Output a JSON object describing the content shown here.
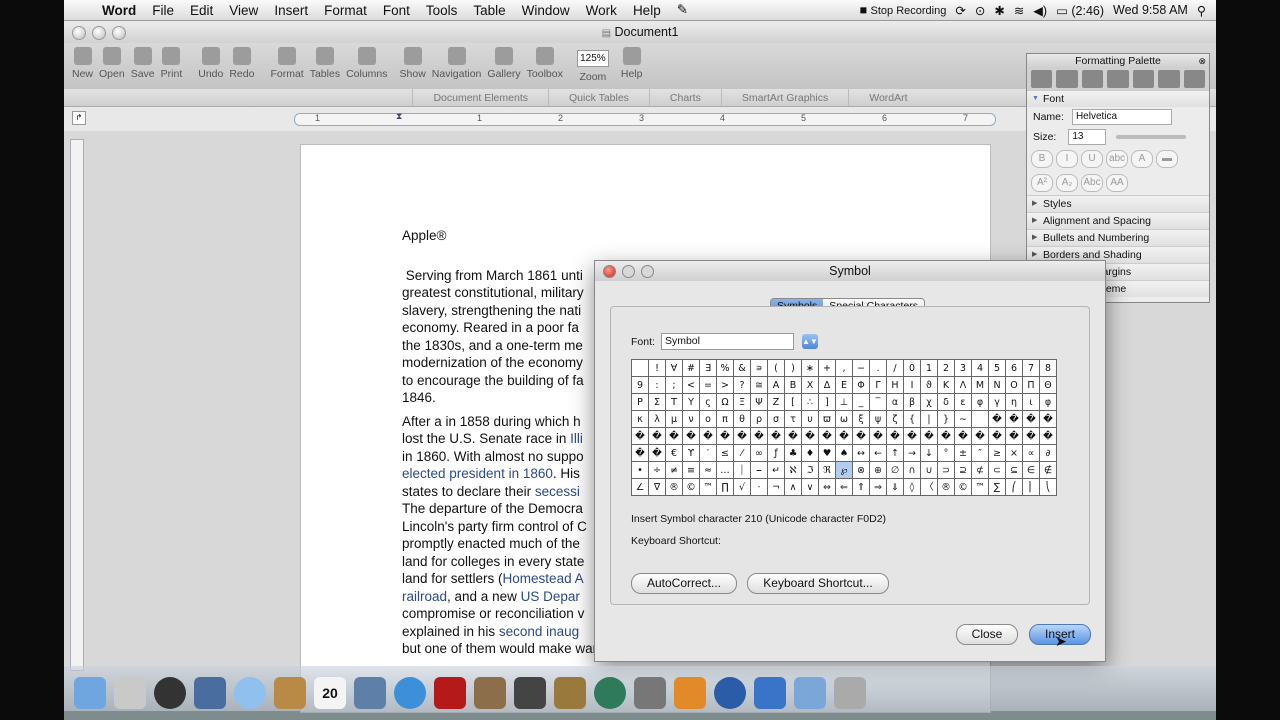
{
  "menubar": {
    "app_name": "Word",
    "items": [
      "File",
      "Edit",
      "View",
      "Insert",
      "Format",
      "Font",
      "Tools",
      "Table",
      "Window",
      "Work",
      "Help"
    ],
    "stop_recording": "Stop Recording",
    "battery": "(2:46)",
    "clock": "Wed 9:58 AM"
  },
  "window": {
    "title": "Document1"
  },
  "toolbar": {
    "items": [
      "New",
      "Open",
      "Save",
      "Print",
      "Undo",
      "Redo",
      "Format",
      "Tables",
      "Columns",
      "Show",
      "Navigation",
      "Gallery",
      "Toolbox",
      "Zoom",
      "Help"
    ],
    "zoom_value": "125%"
  },
  "ribbon": {
    "tabs": [
      "Document Elements",
      "Quick Tables",
      "Charts",
      "SmartArt Graphics",
      "WordArt"
    ]
  },
  "ruler": {
    "numbers": [
      "1",
      "1",
      "2",
      "3",
      "4",
      "5",
      "6",
      "7"
    ]
  },
  "document": {
    "heading": "Apple®",
    "p1": [
      " Serving from March 1861 unti",
      "greatest constitutional, military",
      "slavery, strengthening the nati",
      "economy. Reared in a poor fa",
      "the 1830s, and a one-term me",
      "modernization of the economy",
      "to encourage the building of fa",
      "1846."
    ],
    "p2_line1": "After a in 1858 during which h",
    "p2_line2a": "lost the U.S. Senate race in ",
    "p2_line2b": "Illi",
    "p2_line3": "in 1860. With almost no suppo",
    "p2_line4a": "elected president in 1860",
    "p2_line4b": ". His",
    "p2_line5a": "states to declare their ",
    "p2_line5b": "secessi",
    "p2_line6": "The departure of the Democra",
    "p2_line7": "Lincoln's party firm control of C",
    "p2_line8": "promptly enacted much of the",
    "p2_line9": "land for colleges in every state",
    "p2_line10a": "land for settlers (",
    "p2_line10b": "Homestead A",
    "p2_line11a": "railroad",
    "p2_line11b": ", and a new ",
    "p2_line11c": "US Depar",
    "p2_line12": "compromise or reconciliation v",
    "p2_line13a": "explained in his ",
    "p2_line13b": "second inaug",
    "p2_line14": "but one of them would make war rather than let the Nation survive, and the"
  },
  "palette": {
    "title": "Formatting Palette",
    "font_section": "Font",
    "name_label": "Name:",
    "name_value": "Helvetica",
    "size_label": "Size:",
    "size_value": "13",
    "sections": [
      "Styles",
      "Alignment and Spacing",
      "Bullets and Numbering",
      "Borders and Shading",
      "Document Margins",
      "Document Theme"
    ]
  },
  "symbol_dialog": {
    "title": "Symbol",
    "tab_symbols": "Symbols",
    "tab_special": "Special Characters",
    "font_label": "Font:",
    "font_value": "Symbol",
    "grid": [
      "",
      "!",
      "∀",
      "#",
      "∃",
      "%",
      "&",
      "∍",
      "(",
      ")",
      "∗",
      "+",
      ",",
      "−",
      ".",
      "/",
      "0",
      "1",
      "2",
      "3",
      "4",
      "5",
      "6",
      "7",
      "8",
      "9",
      ":",
      ";",
      "<",
      "=",
      ">",
      "?",
      "≅",
      "Α",
      "Β",
      "Χ",
      "Δ",
      "Ε",
      "Φ",
      "Γ",
      "Η",
      "Ι",
      "ϑ",
      "Κ",
      "Λ",
      "Μ",
      "Ν",
      "Ο",
      "Π",
      "Θ",
      "Ρ",
      "Σ",
      "Τ",
      "Υ",
      "ς",
      "Ω",
      "Ξ",
      "Ψ",
      "Ζ",
      "[",
      "∴",
      "]",
      "⊥",
      "_",
      "‾",
      "α",
      "β",
      "χ",
      "δ",
      "ε",
      "φ",
      "γ",
      "η",
      "ι",
      "φ",
      "κ",
      "λ",
      "μ",
      "ν",
      "ο",
      "π",
      "θ",
      "ρ",
      "σ",
      "τ",
      "υ",
      "ϖ",
      "ω",
      "ξ",
      "ψ",
      "ζ",
      "{",
      "|",
      "}",
      "∼",
      "",
      "�",
      "�",
      "�",
      "�",
      "�",
      "�",
      "�",
      "�",
      "�",
      "�",
      "�",
      "�",
      "�",
      "�",
      "�",
      "�",
      "�",
      "�",
      "�",
      "�",
      "�",
      "�",
      "�",
      "�",
      "�",
      "�",
      "�",
      "�",
      "�",
      "�",
      "�",
      "€",
      "ϒ",
      "′",
      "≤",
      "⁄",
      "∞",
      "ƒ",
      "♣",
      "♦",
      "♥",
      "♠",
      "↔",
      "←",
      "↑",
      "→",
      "↓",
      "°",
      "±",
      "″",
      "≥",
      "×",
      "∝",
      "∂",
      "•",
      "÷",
      "≠",
      "≡",
      "≈",
      "…",
      "⏐",
      "⎯",
      "↵",
      "ℵ",
      "ℑ",
      "ℜ",
      "℘",
      "⊗",
      "⊕",
      "∅",
      "∩",
      "∪",
      "⊃",
      "⊇",
      "⊄",
      "⊂",
      "⊆",
      "∈",
      "∉",
      "∠",
      "∇",
      "®",
      "©",
      "™",
      "∏",
      "√",
      "⋅",
      "¬",
      "∧",
      "∨",
      "⇔",
      "⇐",
      "⇑",
      "⇒",
      "⇓",
      "◊",
      "〈",
      "®",
      "©",
      "™",
      "∑",
      "⎛",
      "⎜",
      "⎝",
      "⎡",
      "⎢",
      "⎣",
      "⎧",
      "⎨",
      "⎩",
      "⎪",
      "",
      "〉",
      "∫",
      "⌠",
      "⎮",
      "⌡",
      "⎞",
      "⎟",
      "⎠",
      "⎤",
      "⎥",
      "⎦",
      "⎫",
      "⎬",
      "⎭",
      "�"
    ],
    "insert_info": "Insert Symbol character 210  (Unicode character F0D2)",
    "keyboard_shortcut_label": "Keyboard Shortcut:",
    "autocorrect_button": "AutoCorrect...",
    "keyboard_shortcut_button": "Keyboard Shortcut...",
    "close_button": "Close",
    "insert_button": "Insert"
  },
  "dock": {
    "date_day": "20",
    "icon_names": [
      "finder-icon",
      "app-store-icon",
      "dashboard-icon",
      "mail-icon",
      "safari-icon",
      "address-book-icon",
      "ical-icon",
      "iphoto-icon",
      "itunes-icon",
      "photo-booth-icon",
      "preview-icon",
      "imovie-icon",
      "garageband-icon",
      "time-machine-icon",
      "system-preferences-icon",
      "pages-icon",
      "quicktime-icon",
      "word-icon",
      "finder-folder-icon",
      "trash-icon"
    ]
  }
}
